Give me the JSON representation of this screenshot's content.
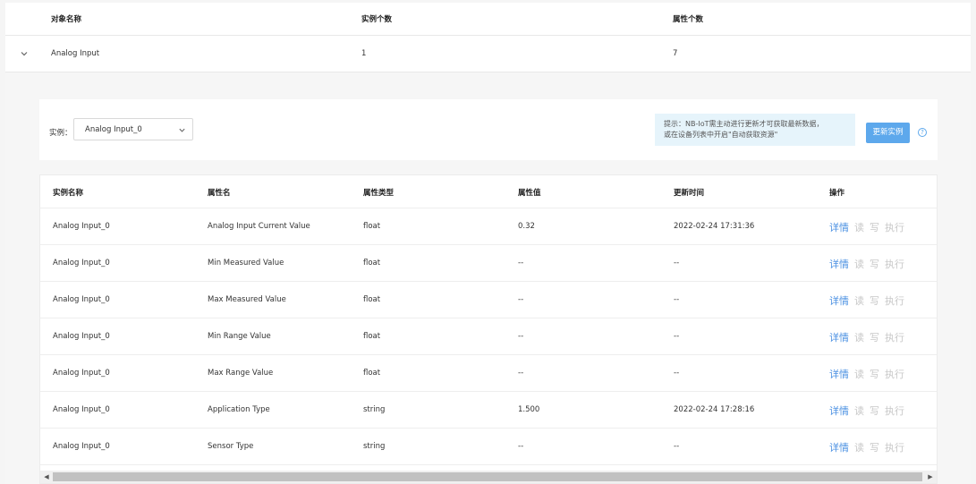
{
  "outer_table": {
    "headers": [
      "对象名称",
      "实例个数",
      "属性个数"
    ],
    "row": {
      "name": "Analog Input",
      "instances": "1",
      "properties": "7"
    }
  },
  "toolbar": {
    "instance_label": "实例：",
    "instance_selected": "Analog Input_0",
    "tip_line1": "提示：NB-IoT需主动进行更新才可获取最新数据，",
    "tip_line2": "或在设备列表中开启\"自动获取资源\"",
    "update_button": "更新实例",
    "help_icon": "?"
  },
  "table": {
    "headers": [
      "实例名称",
      "属性名",
      "属性类型",
      "属性值",
      "更新时间",
      "操作"
    ],
    "actions": {
      "detail": "详情",
      "read": "读",
      "write": "写",
      "execute": "执行"
    },
    "rows": [
      {
        "instance": "Analog Input_0",
        "attr": "Analog Input Current Value",
        "type": "float",
        "value": "0.32",
        "time": "2022-02-24 17:31:36"
      },
      {
        "instance": "Analog Input_0",
        "attr": "Min Measured Value",
        "type": "float",
        "value": "--",
        "time": "--"
      },
      {
        "instance": "Analog Input_0",
        "attr": "Max Measured Value",
        "type": "float",
        "value": "--",
        "time": "--"
      },
      {
        "instance": "Analog Input_0",
        "attr": "Min Range Value",
        "type": "float",
        "value": "--",
        "time": "--"
      },
      {
        "instance": "Analog Input_0",
        "attr": "Max Range Value",
        "type": "float",
        "value": "--",
        "time": "--"
      },
      {
        "instance": "Analog Input_0",
        "attr": "Application Type",
        "type": "string",
        "value": "1.500",
        "time": "2022-02-24 17:28:16"
      },
      {
        "instance": "Analog Input_0",
        "attr": "Sensor Type",
        "type": "string",
        "value": "--",
        "time": "--"
      }
    ]
  },
  "scrollbar": {
    "left_arrow": "◀",
    "right_arrow": "▶"
  }
}
